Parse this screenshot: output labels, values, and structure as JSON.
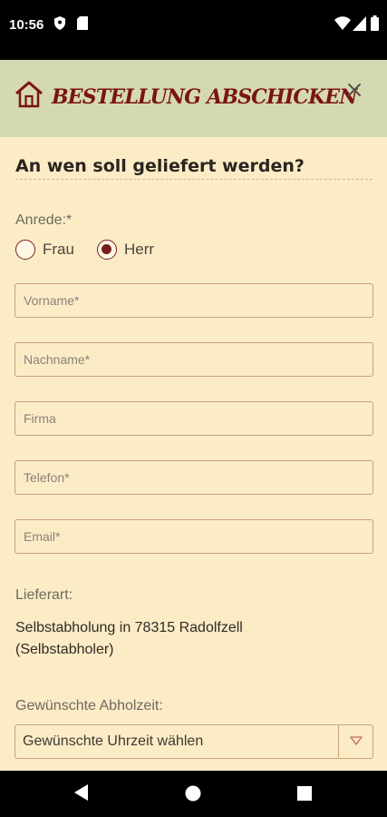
{
  "status_bar": {
    "time": "10:56"
  },
  "header": {
    "title": "BESTELLUNG ABSCHICKEN"
  },
  "form": {
    "section_title": "An wen soll geliefert werden?",
    "salutation_label": "Anrede:*",
    "salutation_options": [
      {
        "label": "Frau",
        "checked": false
      },
      {
        "label": "Herr",
        "checked": true
      }
    ],
    "fields": {
      "firstname_placeholder": "Vorname*",
      "lastname_placeholder": "Nachname*",
      "company_placeholder": "Firma",
      "phone_placeholder": "Telefon*",
      "email_placeholder": "Email*"
    },
    "delivery_label": "Lieferart:",
    "delivery_line1": "Selbstabholung in 78315 Radolfzell",
    "delivery_line2": "(Selbstabholer)",
    "pickup_time_label": "Gewünschte Abholzeit:",
    "pickup_time_value": "Gewünschte Uhrzeit wählen"
  },
  "colors": {
    "header_bg": "#d5d9b1",
    "content_bg": "#fbecc6",
    "accent": "#7a1414",
    "field_border": "#c9a07a"
  },
  "icons": [
    "shield-icon",
    "sd-card-icon",
    "wifi-icon",
    "cell-signal-icon",
    "battery-icon",
    "home-icon",
    "close-icon",
    "dropdown-arrow-icon",
    "back-icon",
    "home-nav-icon",
    "recents-icon"
  ]
}
